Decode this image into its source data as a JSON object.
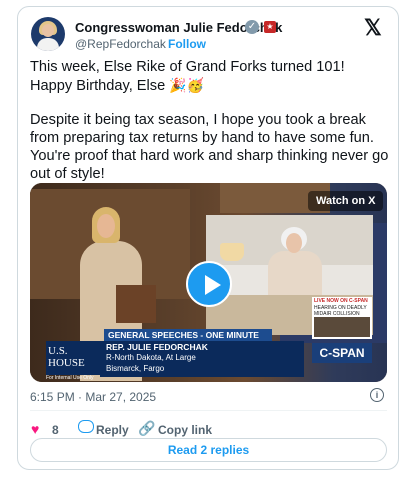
{
  "tweet": {
    "author": {
      "name": "Congresswoman Julie Fedorchak",
      "handle": "@RepFedorchak",
      "separator": "·",
      "follow_label": "Follow",
      "verified_icon": "verified-badge-icon",
      "affiliation_icon": "flag-icon"
    },
    "platform_icon": "x-logo-icon",
    "text_line1": "This week, Else Rike of Grand Forks turned 101! Happy Birthday, Else",
    "emojis": "🎉🥳",
    "text_line2": "Despite it being tax season, I hope you took a break from preparing tax returns by hand to have some fun. You're proof that hard work and sharp thinking never go out of style!",
    "video": {
      "watch_label": "Watch on X",
      "play_icon": "play-icon",
      "lower_third_title": "GENERAL SPEECHES - ONE MINUTE",
      "lower_third_name": "REP. JULIE FEDORCHAK",
      "lower_third_district": "R-North Dakota, At Large",
      "lower_third_city": "Bismarck, Fargo",
      "house_logo_line1": "U.S.",
      "house_logo_line2": "HOUSE",
      "network": "C-SPAN",
      "live_line1": "LIVE NOW ON C-SPAN",
      "live_line2": "HEARING ON DEADLY",
      "live_line3": "MIDAIR COLLISION",
      "internal_note": "For Internal Use Only"
    },
    "timestamp": "6:15 PM · Mar 27, 2025",
    "info_icon": "i",
    "likes": "8",
    "reply_label": "Reply",
    "copy_link_label": "Copy link",
    "read_replies_label": "Read 2 replies"
  }
}
